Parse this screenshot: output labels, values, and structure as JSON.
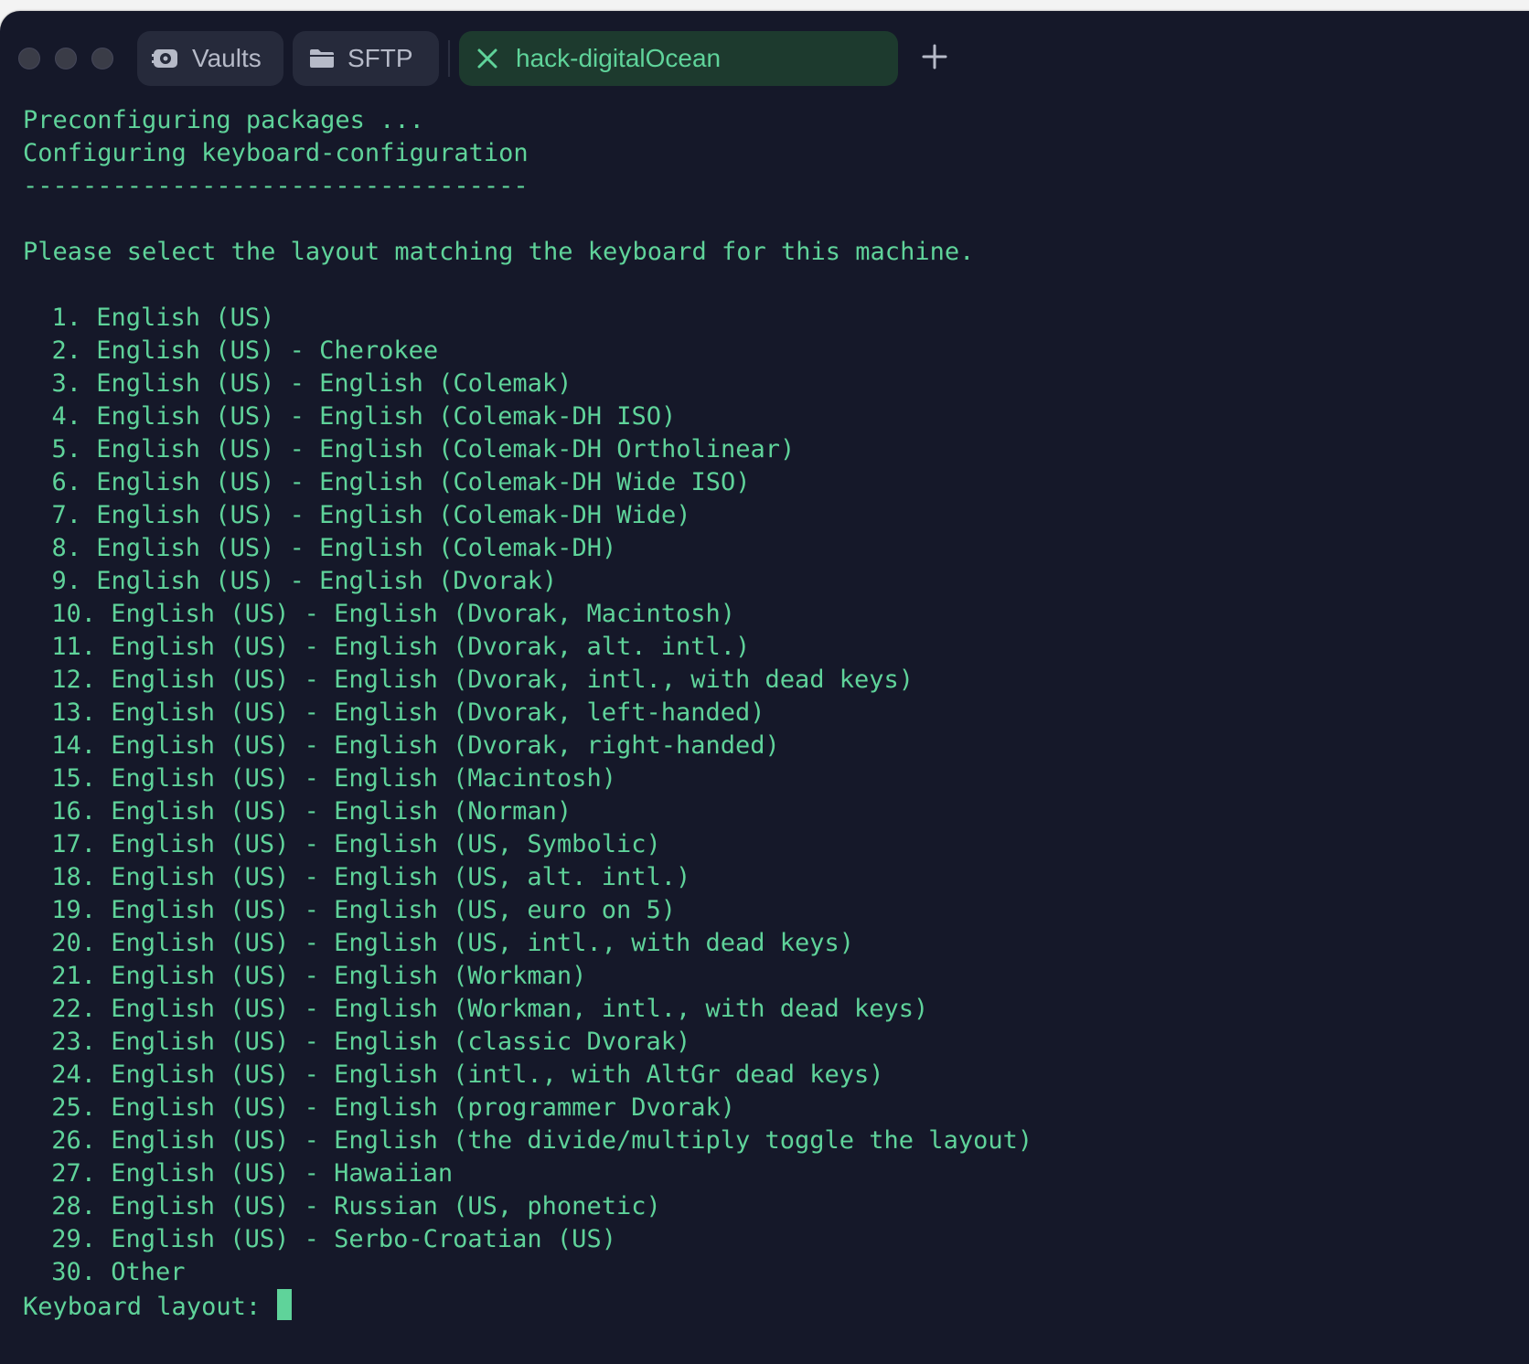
{
  "tabs": [
    {
      "label": "Vaults",
      "icon": "vault-icon",
      "active": false
    },
    {
      "label": "SFTP",
      "icon": "folder-icon",
      "active": false
    },
    {
      "label": "hack-digitalOcean",
      "icon": "close-icon",
      "active": true
    }
  ],
  "new_tab_icon": "plus-icon",
  "colors": {
    "terminal_bg": "#151829",
    "terminal_text": "#5fd39a",
    "active_tab_bg": "#1d3a2e"
  },
  "terminal": {
    "header_lines": [
      "Preconfiguring packages ...",
      "Configuring keyboard-configuration",
      "----------------------------------",
      "",
      "Please select the layout matching the keyboard for this machine.",
      ""
    ],
    "options": [
      {
        "num": "1.",
        "label": "English (US)"
      },
      {
        "num": "2.",
        "label": "English (US) - Cherokee"
      },
      {
        "num": "3.",
        "label": "English (US) - English (Colemak)"
      },
      {
        "num": "4.",
        "label": "English (US) - English (Colemak-DH ISO)"
      },
      {
        "num": "5.",
        "label": "English (US) - English (Colemak-DH Ortholinear)"
      },
      {
        "num": "6.",
        "label": "English (US) - English (Colemak-DH Wide ISO)"
      },
      {
        "num": "7.",
        "label": "English (US) - English (Colemak-DH Wide)"
      },
      {
        "num": "8.",
        "label": "English (US) - English (Colemak-DH)"
      },
      {
        "num": "9.",
        "label": "English (US) - English (Dvorak)"
      },
      {
        "num": "10.",
        "label": "English (US) - English (Dvorak, Macintosh)"
      },
      {
        "num": "11.",
        "label": "English (US) - English (Dvorak, alt. intl.)"
      },
      {
        "num": "12.",
        "label": "English (US) - English (Dvorak, intl., with dead keys)"
      },
      {
        "num": "13.",
        "label": "English (US) - English (Dvorak, left-handed)"
      },
      {
        "num": "14.",
        "label": "English (US) - English (Dvorak, right-handed)"
      },
      {
        "num": "15.",
        "label": "English (US) - English (Macintosh)"
      },
      {
        "num": "16.",
        "label": "English (US) - English (Norman)"
      },
      {
        "num": "17.",
        "label": "English (US) - English (US, Symbolic)"
      },
      {
        "num": "18.",
        "label": "English (US) - English (US, alt. intl.)"
      },
      {
        "num": "19.",
        "label": "English (US) - English (US, euro on 5)"
      },
      {
        "num": "20.",
        "label": "English (US) - English (US, intl., with dead keys)"
      },
      {
        "num": "21.",
        "label": "English (US) - English (Workman)"
      },
      {
        "num": "22.",
        "label": "English (US) - English (Workman, intl., with dead keys)"
      },
      {
        "num": "23.",
        "label": "English (US) - English (classic Dvorak)"
      },
      {
        "num": "24.",
        "label": "English (US) - English (intl., with AltGr dead keys)"
      },
      {
        "num": "25.",
        "label": "English (US) - English (programmer Dvorak)"
      },
      {
        "num": "26.",
        "label": "English (US) - English (the divide/multiply toggle the layout)"
      },
      {
        "num": "27.",
        "label": "English (US) - Hawaiian"
      },
      {
        "num": "28.",
        "label": "English (US) - Russian (US, phonetic)"
      },
      {
        "num": "29.",
        "label": "English (US) - Serbo-Croatian (US)"
      },
      {
        "num": "30.",
        "label": "Other"
      }
    ],
    "prompt": "Keyboard layout: "
  }
}
